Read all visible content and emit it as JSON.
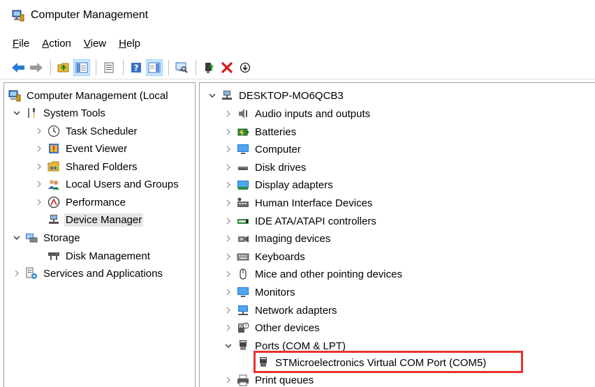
{
  "window": {
    "title": "Computer Management",
    "icon": "computer-management-icon"
  },
  "menu": {
    "items": [
      {
        "label": "File",
        "accel": "F",
        "rest": "ile"
      },
      {
        "label": "Action",
        "accel": "A",
        "rest": "ction"
      },
      {
        "label": "View",
        "accel": "V",
        "rest": "iew"
      },
      {
        "label": "Help",
        "accel": "H",
        "rest": "elp"
      }
    ]
  },
  "toolbar": {
    "buttons": [
      "back-arrow-icon",
      "forward-arrow-icon",
      "up-folder-icon",
      "show-hide-tree-icon",
      "properties-icon",
      "help-icon",
      "show-hide-action-pane-icon",
      "scan-hardware-icon",
      "update-driver-icon",
      "uninstall-device-icon",
      "download-icon"
    ]
  },
  "left_tree": {
    "root": "Computer Management (Local",
    "system_tools": "System Tools",
    "task_scheduler": "Task Scheduler",
    "event_viewer": "Event Viewer",
    "shared_folders": "Shared Folders",
    "local_users": "Local Users and Groups",
    "performance": "Performance",
    "device_manager": "Device Manager",
    "storage": "Storage",
    "disk_management": "Disk Management",
    "services_apps": "Services and Applications"
  },
  "device_tree": {
    "computer_name": "DESKTOP-MO6QCB3",
    "categories": [
      {
        "label": "Audio inputs and outputs",
        "icon": "speaker-icon"
      },
      {
        "label": "Batteries",
        "icon": "battery-icon"
      },
      {
        "label": "Computer",
        "icon": "monitor-icon"
      },
      {
        "label": "Disk drives",
        "icon": "disk-drive-icon"
      },
      {
        "label": "Display adapters",
        "icon": "display-adapter-icon"
      },
      {
        "label": "Human Interface Devices",
        "icon": "hid-icon"
      },
      {
        "label": "IDE ATA/ATAPI controllers",
        "icon": "ide-controller-icon"
      },
      {
        "label": "Imaging devices",
        "icon": "camera-icon"
      },
      {
        "label": "Keyboards",
        "icon": "keyboard-icon"
      },
      {
        "label": "Mice and other pointing devices",
        "icon": "mouse-icon"
      },
      {
        "label": "Monitors",
        "icon": "monitor-icon"
      },
      {
        "label": "Network adapters",
        "icon": "network-icon"
      },
      {
        "label": "Other devices",
        "icon": "unknown-device-icon"
      },
      {
        "label": "Ports (COM & LPT)",
        "icon": "port-icon"
      }
    ],
    "port_child": "STMicroelectronics Virtual COM Port (COM5)",
    "print_queues": "Print queues"
  }
}
